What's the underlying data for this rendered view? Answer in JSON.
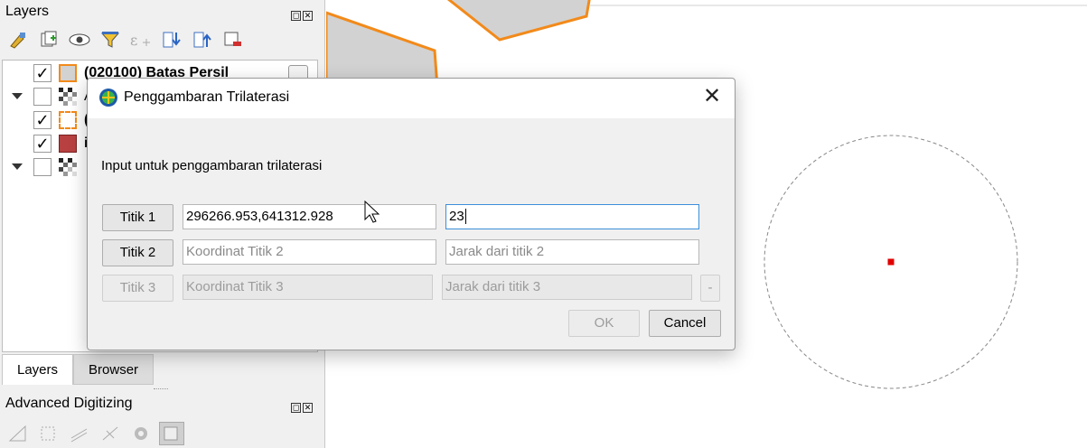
{
  "layers_panel": {
    "title": "Layers",
    "layers": [
      {
        "name": "(020100) Batas Persil",
        "checked": true
      },
      {
        "name": "A",
        "checked": false
      },
      {
        "name": "(",
        "checked": true
      },
      {
        "name": "i",
        "checked": true
      },
      {
        "name": "",
        "checked": false
      }
    ],
    "tabs": [
      "Layers",
      "Browser"
    ]
  },
  "adv_panel": {
    "title": "Advanced Digitizing"
  },
  "dialog": {
    "title": "Penggambaran Trilaterasi",
    "instruction": "Input untuk penggambaran trilaterasi",
    "rows": [
      {
        "button": "Titik 1",
        "coord_value": "296266.953,641312.928",
        "coord_placeholder": "",
        "dist_value": "23",
        "dist_placeholder": ""
      },
      {
        "button": "Titik 2",
        "coord_value": "",
        "coord_placeholder": "Koordinat Titik 2",
        "dist_value": "",
        "dist_placeholder": "Jarak dari titik 2"
      },
      {
        "button": "Titik 3",
        "coord_value": "",
        "coord_placeholder": "Koordinat Titik 3",
        "dist_value": "",
        "dist_placeholder": "Jarak dari titik 3"
      }
    ],
    "remove_label": "-",
    "ok_label": "OK",
    "cancel_label": "Cancel"
  },
  "colors": {
    "parcel_outline": "#f28a1a",
    "parcel_fill": "#d2d2d2",
    "point_marker": "#e00000",
    "focus": "#3b8fd9"
  }
}
